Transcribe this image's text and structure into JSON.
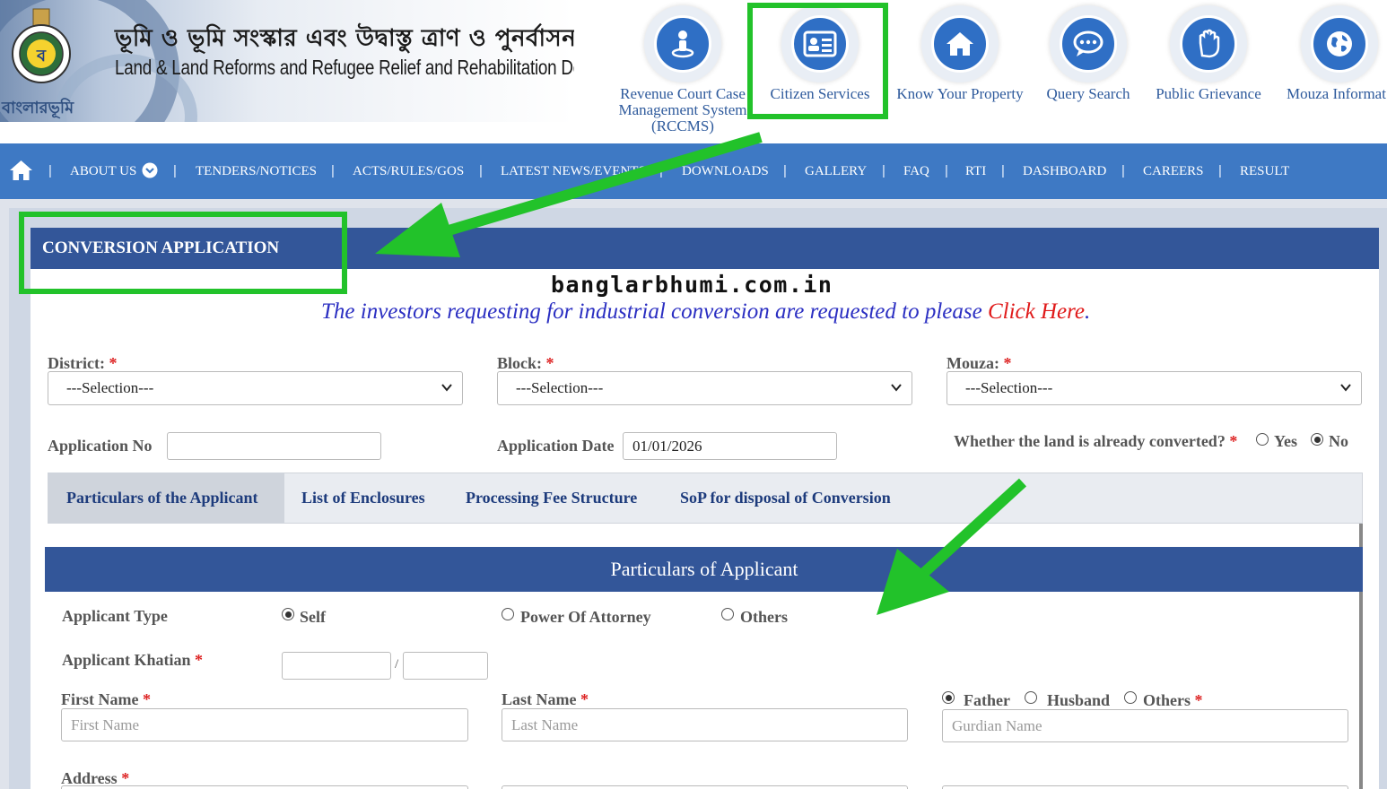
{
  "header": {
    "title_bengali": "ভূমি ও ভূমি সংস্কার এবং উদ্বাস্তু ত্রাণ ও পুনর্বাসন দপ্তর",
    "title_english": "Land & Land Reforms and Refugee Relief and Rehabilitation Department",
    "brand": "বাংলারভূমি",
    "services": [
      {
        "label": "Revenue Court Case Management System (RCCMS)",
        "line1": "Revenue Court Case",
        "line2": "Management System",
        "line3": "(RCCMS)",
        "icon": "person-icon"
      },
      {
        "label": "Citizen Services",
        "icon": "id-card-icon"
      },
      {
        "label": "Know Your Property",
        "icon": "home-icon"
      },
      {
        "label": "Query Search",
        "icon": "chat-icon"
      },
      {
        "label": "Public Grievance",
        "icon": "hand-icon"
      },
      {
        "label": "Mouza Informat",
        "icon": "globe-icon"
      }
    ]
  },
  "nav": {
    "items": [
      "ABOUT US",
      "TENDERS/NOTICES",
      "ACTS/RULES/GOS",
      "LATEST NEWS/EVENTS",
      "DOWNLOADS",
      "GALLERY",
      "FAQ",
      "RTI",
      "DASHBOARD",
      "CAREERS",
      "RESULT"
    ]
  },
  "main": {
    "title": "CONVERSION APPLICATION",
    "watermark": "banglarbhumi.com.in",
    "notice_text": "The investors requesting for industrial conversion are requested to please ",
    "notice_link": "Click Here",
    "district_label": "District:",
    "block_label": "Block:",
    "mouza_label": "Mouza:",
    "select_placeholder": "---Selection---",
    "app_no_label": "Application No",
    "app_no_value": "",
    "app_date_label": "Application Date",
    "app_date_value": "01/01/2026",
    "converted_label": "Whether the land is already converted?",
    "converted_options": [
      "Yes",
      "No"
    ],
    "converted_selected": "No"
  },
  "tabs": [
    "Particulars of the Applicant",
    "List of Enclosures",
    "Processing Fee Structure",
    "SoP for disposal of Conversion"
  ],
  "applicant": {
    "section_title": "Particulars of Applicant",
    "type_label": "Applicant Type",
    "type_options": [
      "Self",
      "Power Of Attorney",
      "Others"
    ],
    "type_selected": "Self",
    "khatian_label": "Applicant Khatian",
    "khatian_sep": "/",
    "first_name_label": "First Name",
    "first_name_placeholder": "First Name",
    "last_name_label": "Last Name",
    "last_name_placeholder": "Last Name",
    "guardian_options": [
      "Father",
      "Husband",
      "Others"
    ],
    "guardian_selected": "Father",
    "guardian_placeholder": "Gurdian Name",
    "address_label": "Address",
    "required_mark": "*"
  },
  "colors": {
    "nav_blue": "#3e79c4",
    "title_bar": "#335699",
    "highlight_green": "#22c22a",
    "link_red": "#e01919",
    "notice_blue": "#2b2fc2"
  }
}
